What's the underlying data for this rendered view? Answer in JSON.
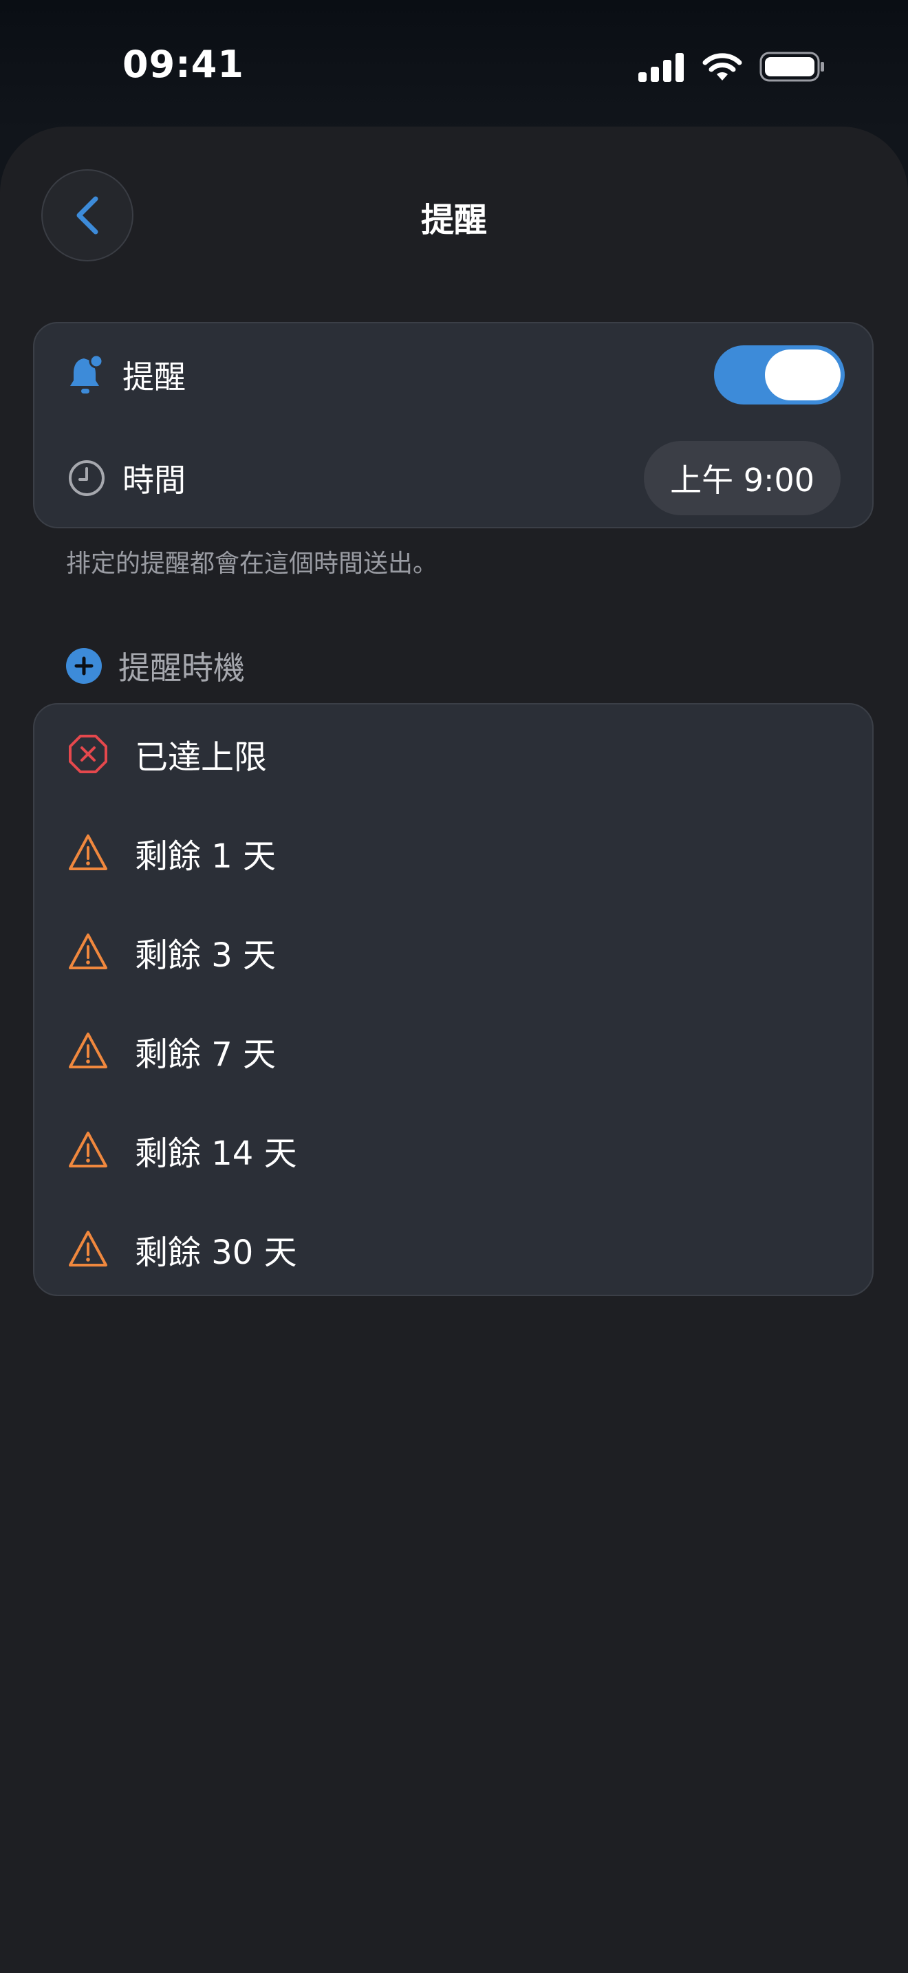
{
  "status_bar": {
    "time": "09:41"
  },
  "nav": {
    "title": "提醒"
  },
  "settings": {
    "reminder_label": "提醒",
    "reminder_enabled": true,
    "time_label": "時間",
    "time_value": "上午 9:00"
  },
  "footnote": "排定的提醒都會在這個時間送出。",
  "timings": {
    "header": "提醒時機",
    "items": [
      {
        "label": "已達上限",
        "icon": "x-octagon-icon",
        "color": "#e5484d"
      },
      {
        "label": "剩餘 1 天",
        "icon": "warning-triangle-icon",
        "color": "#f0883e"
      },
      {
        "label": "剩餘 3 天",
        "icon": "warning-triangle-icon",
        "color": "#f0883e"
      },
      {
        "label": "剩餘 7 天",
        "icon": "warning-triangle-icon",
        "color": "#f0883e"
      },
      {
        "label": "剩餘 14 天",
        "icon": "warning-triangle-icon",
        "color": "#f0883e"
      },
      {
        "label": "剩餘 30 天",
        "icon": "warning-triangle-icon",
        "color": "#f0883e"
      }
    ]
  },
  "colors": {
    "accent": "#3d8bd9",
    "background": "#1e1f23",
    "card": "#2b2f37"
  }
}
